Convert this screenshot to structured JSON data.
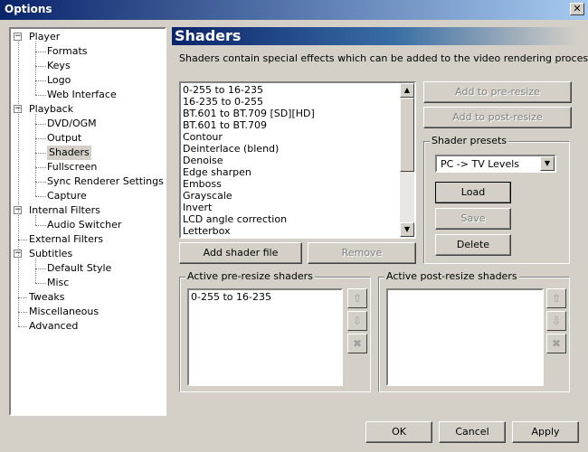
{
  "window": {
    "title": "Options",
    "close_glyph": "✕"
  },
  "tree": [
    {
      "label": "Player",
      "level": 0,
      "expander": "−"
    },
    {
      "label": "Formats",
      "level": 1
    },
    {
      "label": "Keys",
      "level": 1
    },
    {
      "label": "Logo",
      "level": 1
    },
    {
      "label": "Web Interface",
      "level": 1
    },
    {
      "label": "Playback",
      "level": 0,
      "expander": "−"
    },
    {
      "label": "DVD/OGM",
      "level": 1
    },
    {
      "label": "Output",
      "level": 1
    },
    {
      "label": "Shaders",
      "level": 1,
      "selected": true
    },
    {
      "label": "Fullscreen",
      "level": 1
    },
    {
      "label": "Sync Renderer Settings",
      "level": 1
    },
    {
      "label": "Capture",
      "level": 1
    },
    {
      "label": "Internal Filters",
      "level": 0,
      "expander": "−"
    },
    {
      "label": "Audio Switcher",
      "level": 1
    },
    {
      "label": "External Filters",
      "level": 0
    },
    {
      "label": "Subtitles",
      "level": 0,
      "expander": "−"
    },
    {
      "label": "Default Style",
      "level": 1
    },
    {
      "label": "Misc",
      "level": 1
    },
    {
      "label": "Tweaks",
      "level": 0
    },
    {
      "label": "Miscellaneous",
      "level": 0
    },
    {
      "label": "Advanced",
      "level": 0
    }
  ],
  "page": {
    "title": "Shaders",
    "description": "Shaders contain special effects which can be added to the video rendering process."
  },
  "shader_list": [
    "0-255 to 16-235",
    "16-235 to 0-255",
    "BT.601 to BT.709 [SD][HD]",
    "BT.601 to BT.709",
    "Contour",
    "Deinterlace (blend)",
    "Denoise",
    "Edge sharpen",
    "Emboss",
    "Grayscale",
    "Invert",
    "LCD angle correction",
    "Letterbox"
  ],
  "buttons": {
    "add_pre": "Add to pre-resize",
    "add_post": "Add to post-resize",
    "add_shader_file": "Add shader file",
    "remove": "Remove",
    "load": "Load",
    "save": "Save",
    "delete": "Delete",
    "ok": "OK",
    "cancel": "Cancel",
    "apply": "Apply"
  },
  "presets": {
    "label": "Shader presets",
    "selected": "PC -> TV Levels"
  },
  "pre_resize": {
    "label": "Active pre-resize shaders",
    "items": [
      "0-255 to 16-235"
    ]
  },
  "post_resize": {
    "label": "Active post-resize shaders",
    "items": []
  },
  "glyphs": {
    "up": "⇧",
    "down": "⇩",
    "remove": "✖",
    "scroll_up": "▲",
    "scroll_down": "▼",
    "dropdown": "▼"
  }
}
